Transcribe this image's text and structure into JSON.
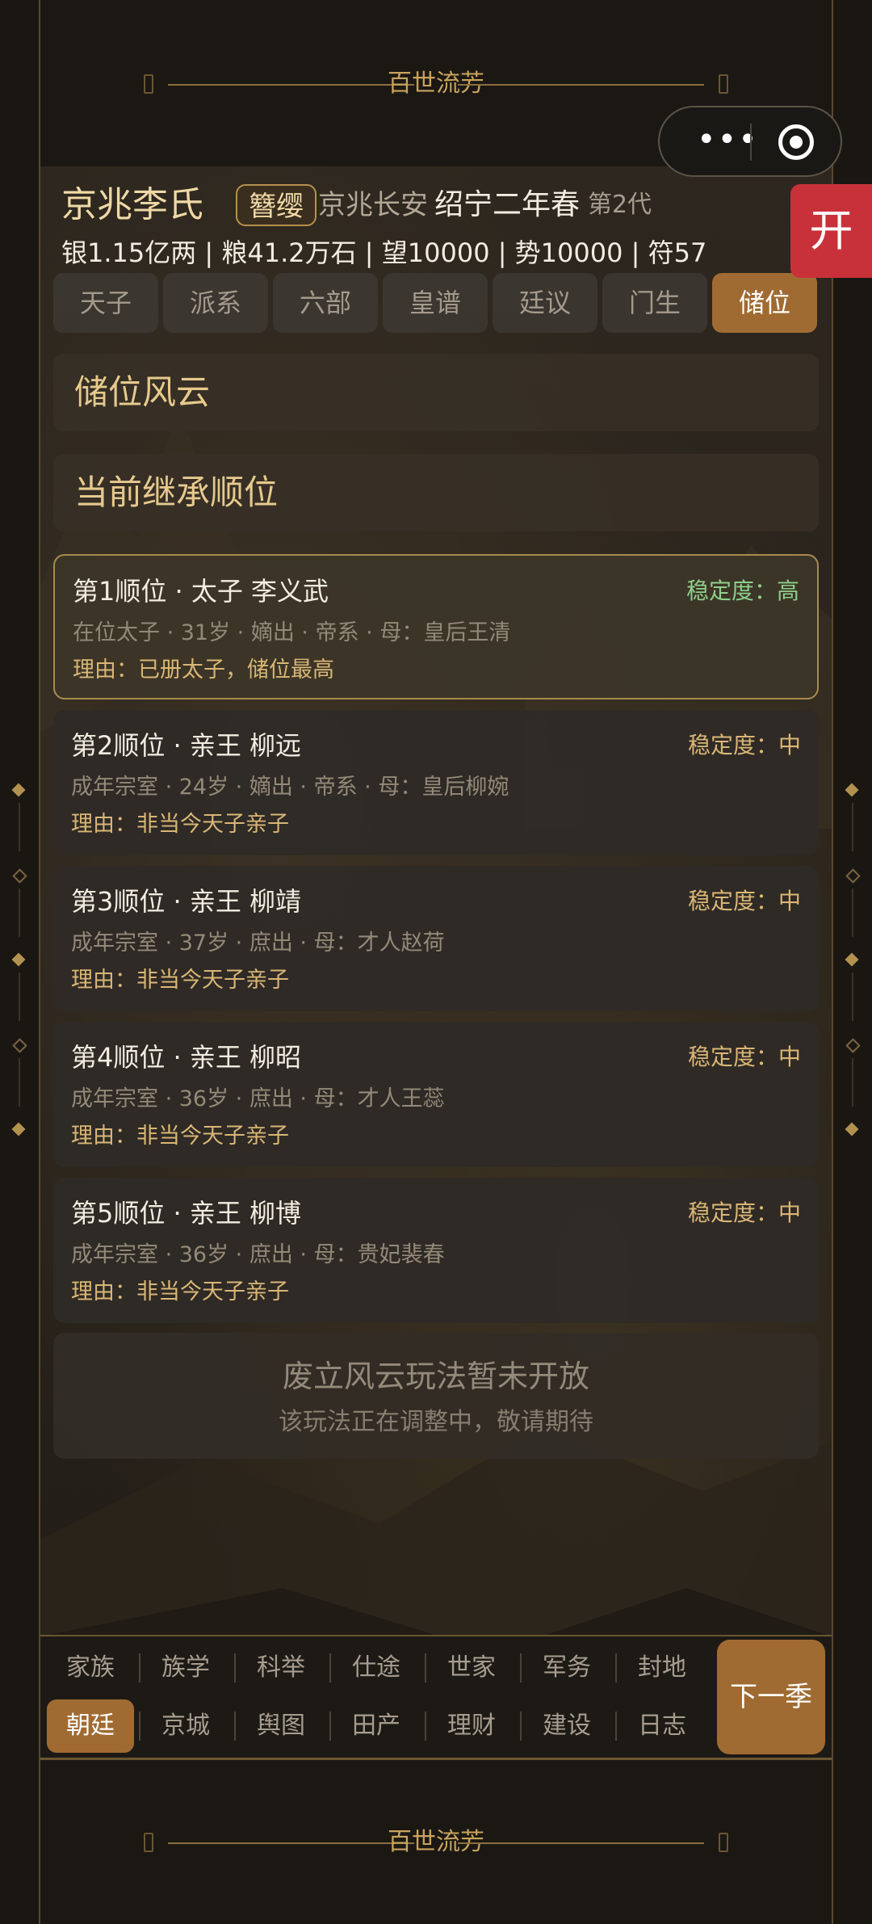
{
  "banner": {
    "top_title": "百世流芳",
    "bottom_title": "百世流芳"
  },
  "capsule": {
    "more_icon": "more-dots-icon",
    "close_icon": "target-circle-icon",
    "more_glyph": "•••"
  },
  "side_tag": {
    "label": "开"
  },
  "header": {
    "clan": "京兆李氏",
    "rank": "簪缨",
    "place": "京兆长安",
    "era": "绍宁二年春",
    "generation": "第2代",
    "stats": "银1.15亿两 | 粮41.2万石 | 望10000 | 势10000 | 符57"
  },
  "tabs": [
    {
      "label": "天子"
    },
    {
      "label": "派系"
    },
    {
      "label": "六部"
    },
    {
      "label": "皇谱"
    },
    {
      "label": "廷议"
    },
    {
      "label": "门生"
    },
    {
      "label": "储位",
      "active": true
    }
  ],
  "section_title": "储位风云",
  "subsection_title": "当前继承顺位",
  "successors": [
    {
      "title": "第1顺位 · 太子 李义武",
      "stability": "稳定度：高",
      "info": "在位太子 · 31岁 · 嫡出 · 帝系 · 母：皇后王清",
      "reason": "理由：已册太子，储位最高"
    },
    {
      "title": "第2顺位 · 亲王 柳远",
      "stability": "稳定度：中",
      "info": "成年宗室 · 24岁 · 嫡出 · 帝系 · 母：皇后柳婉",
      "reason": "理由：非当今天子亲子"
    },
    {
      "title": "第3顺位 · 亲王 柳靖",
      "stability": "稳定度：中",
      "info": "成年宗室 · 37岁 · 庶出 · 母：才人赵荷",
      "reason": "理由：非当今天子亲子"
    },
    {
      "title": "第4顺位 · 亲王 柳昭",
      "stability": "稳定度：中",
      "info": "成年宗室 · 36岁 · 庶出 · 母：才人王蕊",
      "reason": "理由：非当今天子亲子"
    },
    {
      "title": "第5顺位 · 亲王 柳博",
      "stability": "稳定度：中",
      "info": "成年宗室 · 36岁 · 庶出 · 母：贵妃裴春",
      "reason": "理由：非当今天子亲子"
    }
  ],
  "closed_notice": {
    "title": "废立风云玩法暂未开放",
    "subtitle": "该玩法正在调整中，敬请期待"
  },
  "nav": {
    "row1": [
      "家族",
      "族学",
      "科举",
      "仕途",
      "世家",
      "军务",
      "封地"
    ],
    "row2": [
      "朝廷",
      "京城",
      "舆图",
      "田产",
      "理财",
      "建设",
      "日志"
    ],
    "active": "朝廷",
    "next": "下一季"
  },
  "colors": {
    "accent": "#a06b32",
    "gold": "#d9b676",
    "stability_high": "#8fcf8a",
    "tag_red": "#c9313a"
  }
}
